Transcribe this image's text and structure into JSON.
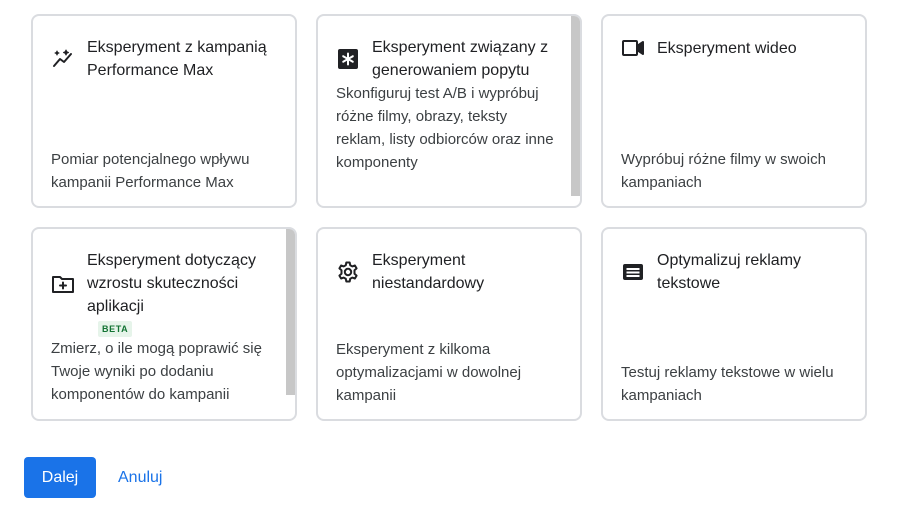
{
  "cards": [
    {
      "title": "Eksperyment z kampanią Performance Max",
      "description": "Pomiar potencjalnego wpływu kampanii Performance Max",
      "icon": "trending-sparkle-icon"
    },
    {
      "title": "Eksperyment związany z generowaniem popytu",
      "description": "Skonfiguruj test A/B i wypróbuj różne filmy, obrazy, teksty reklam, listy odbiorców oraz inne komponenty",
      "icon": "asterisk-box-icon"
    },
    {
      "title": "Eksperyment wideo",
      "description": "Wypróbuj różne filmy w swoich kampaniach",
      "icon": "videocam-icon"
    },
    {
      "title": "Eksperyment dotyczący wzrostu skuteczności aplikacji",
      "badge": "BETA",
      "description": "Zmierz, o ile mogą poprawić się Twoje wyniki po dodaniu komponentów do kampanii promującej aplikację",
      "icon": "folder-add-icon"
    },
    {
      "title": "Eksperyment niestandardowy",
      "description": "Eksperyment z kilkoma optymalizacjami w dowolnej kampanii",
      "icon": "gear-icon"
    },
    {
      "title": "Optymalizuj reklamy tekstowe",
      "description": "Testuj reklamy tekstowe w wielu kampaniach",
      "icon": "text-ad-icon"
    }
  ],
  "actions": {
    "next_label": "Dalej",
    "cancel_label": "Anuluj"
  },
  "colors": {
    "accent": "#1a73e8",
    "border": "#dadce0",
    "beta_bg": "#e6f4ea",
    "beta_text": "#137333"
  }
}
